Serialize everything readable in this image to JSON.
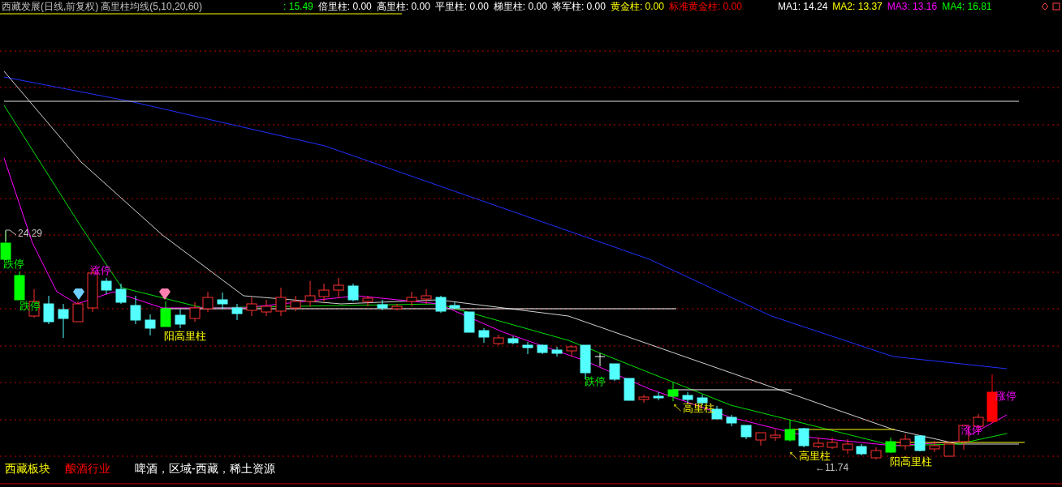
{
  "header": {
    "title": "西藏发展(日线,前复权)",
    "indicator": "高里柱均线(5,10,20,60)",
    "price": ": 15.49",
    "readings": [
      {
        "label": "倍里柱",
        "value": ": 0.00",
        "color": "#ffffff"
      },
      {
        "label": "高里柱",
        "value": ": 0.00",
        "color": "#ffffff"
      },
      {
        "label": "平里柱",
        "value": ": 0.00",
        "color": "#ffffff"
      },
      {
        "label": "梯里柱",
        "value": ": 0.00",
        "color": "#ffffff"
      },
      {
        "label": "将军柱",
        "value": ": 0.00",
        "color": "#ffffff"
      },
      {
        "label": "黄金柱",
        "value": ": 0.00",
        "color": "#ffff00"
      },
      {
        "label": "标准黄金柱",
        "value": ": 0.00",
        "color": "#ff0000"
      }
    ],
    "averages": [
      {
        "label": "MA1",
        "value": ": 14.24",
        "color": "#ffffff"
      },
      {
        "label": "MA2",
        "value": ": 13.37",
        "color": "#ffff00"
      },
      {
        "label": "MA3",
        "value": ": 13.16",
        "color": "#ff00ff"
      },
      {
        "label": "MA4",
        "value": ": 16.81",
        "color": "#00ff00"
      }
    ]
  },
  "annotations": [
    {
      "kind": "price",
      "text": "24.29"
    },
    {
      "kind": "limit-down",
      "text": "跌停"
    },
    {
      "kind": "limit-down",
      "text": "跌停"
    },
    {
      "kind": "limit-up",
      "text": "涨停"
    },
    {
      "kind": "yang",
      "text": "阳高里柱"
    },
    {
      "kind": "limit-down",
      "text": "跌停"
    },
    {
      "kind": "arrow",
      "text": "↖高里柱"
    },
    {
      "kind": "arrow",
      "text": "↖高里柱"
    },
    {
      "kind": "price",
      "text": "←11.74"
    },
    {
      "kind": "yang",
      "text": "阳高里柱"
    },
    {
      "kind": "limit-up",
      "text": "涨停"
    },
    {
      "kind": "limit-up",
      "text": "涨停"
    }
  ],
  "tags": [
    {
      "text": "西藏板块",
      "color": "#ffff00"
    },
    {
      "text": "酿酒行业",
      "color": "#ff0000"
    },
    {
      "text": "啤酒，区域-西藏，稀土资源",
      "color": "#ffffff"
    }
  ]
}
